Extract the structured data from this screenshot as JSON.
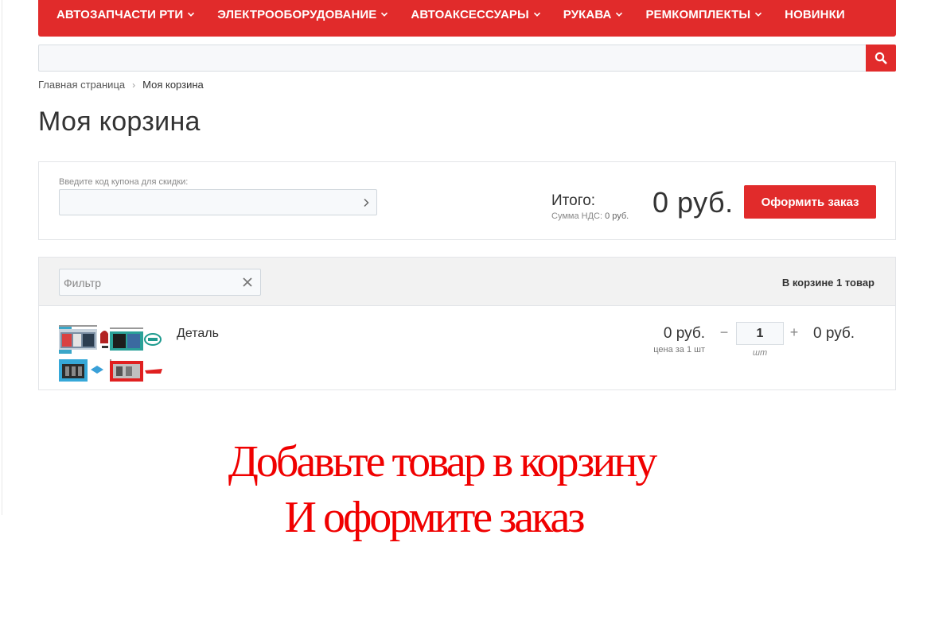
{
  "nav": {
    "items": [
      {
        "label": "АВТОЗАПЧАСТИ РТИ",
        "has_dropdown": true
      },
      {
        "label": "ЭЛЕКТРООБОРУДОВАНИЕ",
        "has_dropdown": true
      },
      {
        "label": "АВТОАКСЕССУАРЫ",
        "has_dropdown": true
      },
      {
        "label": "РУКАВА",
        "has_dropdown": true
      },
      {
        "label": "РЕМКОМПЛЕКТЫ",
        "has_dropdown": true
      },
      {
        "label": "НОВИНКИ",
        "has_dropdown": false
      }
    ]
  },
  "search": {
    "value": "",
    "icon": "search-icon"
  },
  "breadcrumb": {
    "home": "Главная страница",
    "current": "Моя корзина"
  },
  "page": {
    "title": "Моя корзина"
  },
  "summary": {
    "coupon_label": "Введите код купона для скидки:",
    "coupon_value": "",
    "total_label": "Итого:",
    "vat_label": "Сумма НДС:",
    "vat_value": "0 руб.",
    "total_value": "0 руб.",
    "checkout_label": "Оформить заказ"
  },
  "cart": {
    "filter_placeholder": "Фильтр",
    "count_text": "В корзине 1 товар",
    "items": [
      {
        "name": "Деталь",
        "unit_price": "0 руб.",
        "unit_price_note": "цена за 1 шт",
        "quantity": "1",
        "unit": "шт",
        "line_total": "0 руб."
      }
    ]
  },
  "promo": {
    "line1": "Добавьте товар в корзину",
    "line2": "И оформите заказ"
  },
  "colors": {
    "brand_red": "#e12b2b",
    "promo_red": "#f00000"
  }
}
